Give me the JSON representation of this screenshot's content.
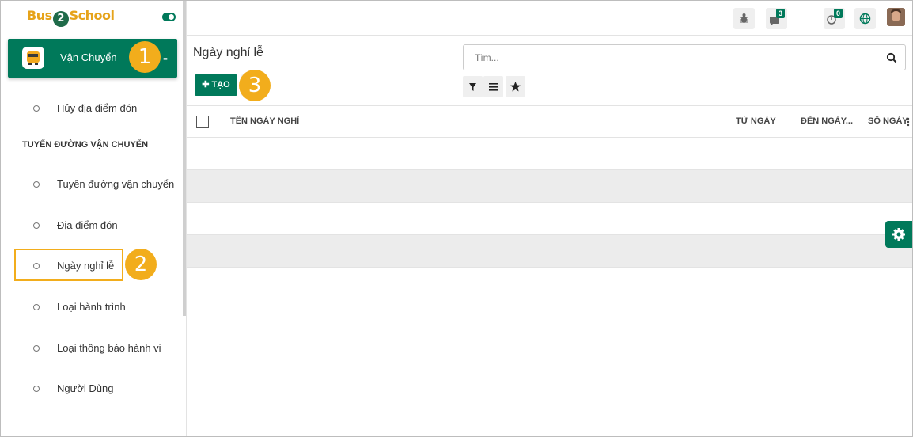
{
  "brand": {
    "logo_part1": "Bus",
    "logo_part2": "2",
    "logo_part3": "School"
  },
  "app_menu": {
    "label": "Vận Chuyển",
    "collapse_symbol": "-"
  },
  "callouts": {
    "one": "1",
    "two": "2",
    "three": "3"
  },
  "sidebar": {
    "item_cancel_pickup": "Hủy địa điểm đón",
    "section_title": "TUYẾN ĐƯỜNG VẬN CHUYỂN",
    "items": [
      "Tuyến đường vận chuyển",
      "Địa điểm đón",
      "Ngày nghỉ lễ",
      "Loại hành trình",
      "Loại thông báo hành vi",
      "Người Dùng"
    ]
  },
  "topbar": {
    "messages_count": "3",
    "activity_count": "0"
  },
  "control_panel": {
    "title": "Ngày nghỉ lễ",
    "create_label": "TẠO",
    "search_placeholder": "Tìm..."
  },
  "table": {
    "columns": [
      "TÊN NGÀY NGHỈ",
      "TỪ NGÀY",
      "ĐẾN NGÀY...",
      "SỐ NGÀY"
    ]
  },
  "colors": {
    "primary": "#00795a",
    "callout": "#f2ad1c"
  },
  "icons": {
    "bug": "bug-icon",
    "messages": "chat-icon",
    "activity": "clock-icon",
    "website": "globe-icon",
    "filter": "filter-icon",
    "group": "list-icon",
    "favorite": "star-icon",
    "search": "search-icon",
    "settings": "gear-icon"
  }
}
